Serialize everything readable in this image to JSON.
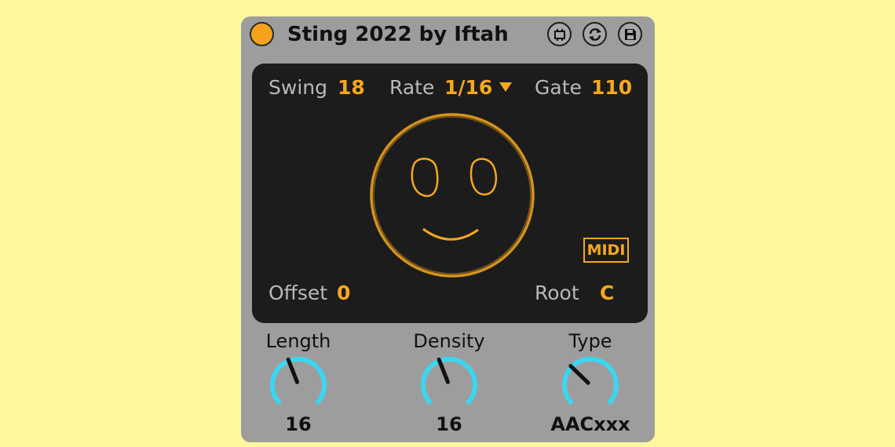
{
  "device": {
    "title": "Sting 2022 by Iftah",
    "accent_color": "#f6a81c",
    "knob_color": "#3bd6f0",
    "titlebar_buttons": [
      "freeze-icon",
      "refresh-icon",
      "save-icon"
    ]
  },
  "screen": {
    "swing": {
      "label": "Swing",
      "value": "18"
    },
    "rate": {
      "label": "Rate",
      "value": "1/16",
      "dropdown_icon": "triangle-down-icon"
    },
    "gate": {
      "label": "Gate",
      "value": "110"
    },
    "offset": {
      "label": "Offset",
      "value": "0"
    },
    "root": {
      "label": "Root",
      "value": "C"
    },
    "midi_badge": "MIDI",
    "center_icon": "smiley-face-icon"
  },
  "knobs": [
    {
      "label": "Length",
      "value": "16",
      "position": 0.42
    },
    {
      "label": "Density",
      "value": "16",
      "position": 0.42
    },
    {
      "label": "Type",
      "value": "AACxxx",
      "position": 0.33
    }
  ]
}
